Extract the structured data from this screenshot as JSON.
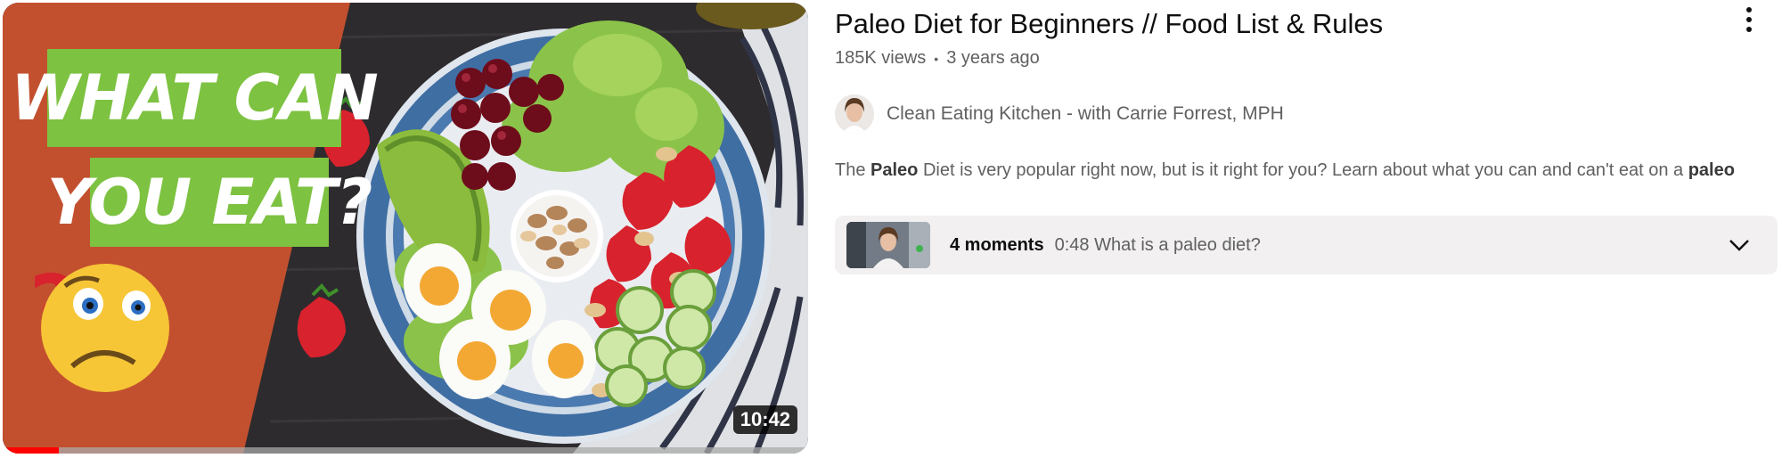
{
  "video": {
    "thumbnail": {
      "text_line1": "WHAT CAN",
      "text_line2": "YOU EAT?",
      "emoji": "confused-face-emoji",
      "duration": "10:42",
      "watch_progress": 0.07
    },
    "title": "Paleo Diet for Beginners // Food List & Rules",
    "views": "185K views",
    "age": "3 years ago",
    "channel": "Clean Eating Kitchen - with Carrie Forrest, MPH",
    "description": {
      "before": "The ",
      "bold": "Paleo",
      "after": " Diet is very popular right now, but is it right for you? Learn about what you can and can't eat on a ",
      "tail_bold": "paleo"
    },
    "moments": {
      "count": "4 moments",
      "chapter": "0:48 What is a paleo diet?"
    }
  },
  "icons": {
    "more": "more-vert-icon",
    "expand": "chevron-down-icon"
  },
  "colors": {
    "thumb_orange": "#c2502f",
    "thumb_green": "#7dc241",
    "progress_red": "#ff0000",
    "secondary_text": "#606060",
    "moments_bg": "#f2f0f0"
  }
}
